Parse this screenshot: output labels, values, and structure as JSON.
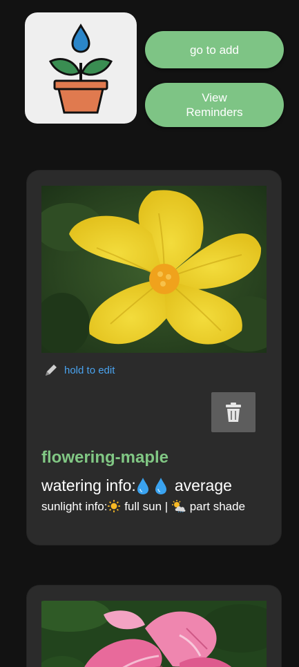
{
  "app": {
    "logo_icon": "potted-plant-water-drop-icon"
  },
  "actions": {
    "add_label": "go to add",
    "reminders_label": "View\nReminders",
    "accent_color": "#7ec485"
  },
  "plants": [
    {
      "photo": "yellow-flower-photo",
      "edit_label": "hold to edit",
      "edit_icon": "pencil-icon",
      "delete_icon": "trash-icon",
      "name": "flowering-maple",
      "watering_prefix": "watering info:",
      "watering_drops": 2,
      "watering_level": "average",
      "sunlight_prefix": "sunlight info:",
      "sunlight_full": "full sun",
      "sunlight_separator": "|",
      "sunlight_part": "part shade"
    },
    {
      "photo": "pink-flower-photo"
    }
  ],
  "colors": {
    "background": "#121212",
    "card": "#2b2b2b",
    "plant_name": "#81c784",
    "edit_link": "#4aa3ef"
  }
}
